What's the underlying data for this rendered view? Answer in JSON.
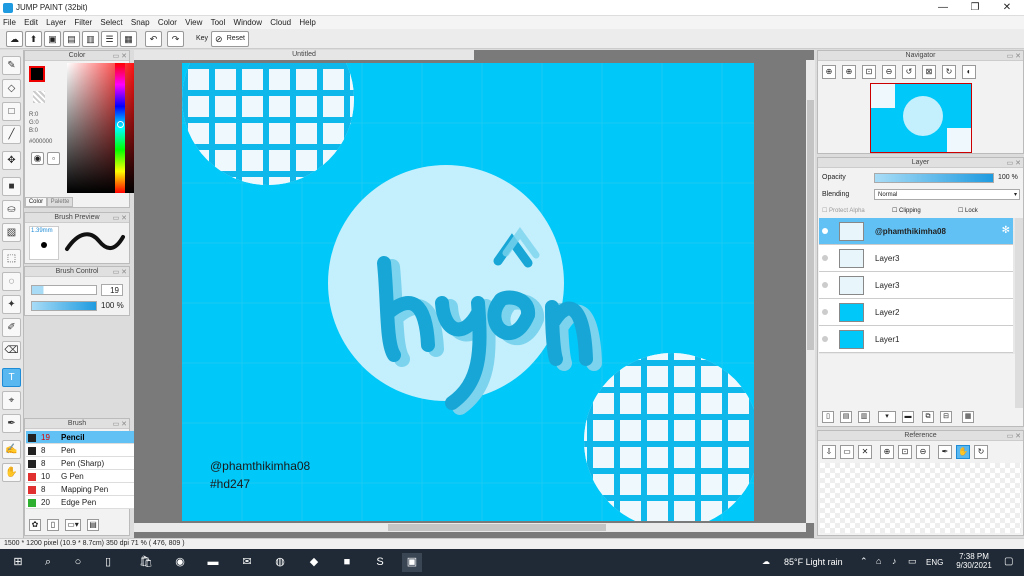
{
  "window": {
    "title": "JUMP PAINT (32bit)",
    "minimize": "—",
    "maximize": "❐",
    "close": "✕"
  },
  "menu": [
    "File",
    "Edit",
    "Layer",
    "Filter",
    "Select",
    "Snap",
    "Color",
    "View",
    "Tool",
    "Window",
    "Cloud",
    "Help"
  ],
  "toolbar": {
    "key_label": "Key",
    "reset_label": "Reset"
  },
  "color_panel": {
    "title": "Color",
    "r": "R:0",
    "g": "G:0",
    "b": "B:0",
    "hex": "#000000",
    "tab_color": "Color",
    "tab_palette": "Palette",
    "fg_color": "#000000"
  },
  "brush_preview": {
    "title": "Brush Preview",
    "size": "1.39mm"
  },
  "brush_control": {
    "title": "Brush Control",
    "size_value": "19",
    "opacity_value": "100 %"
  },
  "brush_panel": {
    "title": "Brush",
    "items": [
      {
        "size": "19",
        "name": "Pencil",
        "color": "#222222"
      },
      {
        "size": "8",
        "name": "Pen",
        "color": "#222222"
      },
      {
        "size": "8",
        "name": "Pen (Sharp)",
        "color": "#222222"
      },
      {
        "size": "10",
        "name": "G Pen",
        "color": "#e03030"
      },
      {
        "size": "8",
        "name": "Mapping Pen",
        "color": "#e03030"
      },
      {
        "size": "20",
        "name": "Edge Pen",
        "color": "#30b030"
      }
    ]
  },
  "document": {
    "tab_title": "Untitled"
  },
  "canvas_content": {
    "signature_line1": "@phamthikimha08",
    "signature_line2": "#hd247",
    "bg_color": "#00c8f8"
  },
  "navigator": {
    "title": "Navigator"
  },
  "layer_panel": {
    "title": "Layer",
    "opacity_label": "Opacity",
    "opacity_value": "100 %",
    "blending_label": "Blending",
    "blending_value": "Normal",
    "protect_alpha": "Protect Alpha",
    "clipping": "Clipping",
    "lock": "Lock",
    "layers": [
      {
        "name": "@phamthikimha08",
        "selected": true
      },
      {
        "name": "Layer3",
        "selected": false
      },
      {
        "name": "Layer3",
        "selected": false
      },
      {
        "name": "Layer2",
        "selected": false
      },
      {
        "name": "Layer1",
        "selected": false
      }
    ]
  },
  "reference": {
    "title": "Reference"
  },
  "status": {
    "text": "1500 * 1200 pixel  (10.9 * 8.7cm)  350 dpi  71 %  ( 476, 809 )"
  },
  "taskbar": {
    "weather": "85°F  Light rain",
    "lang": "ENG",
    "time": "7:38 PM",
    "date": "9/30/2021"
  }
}
